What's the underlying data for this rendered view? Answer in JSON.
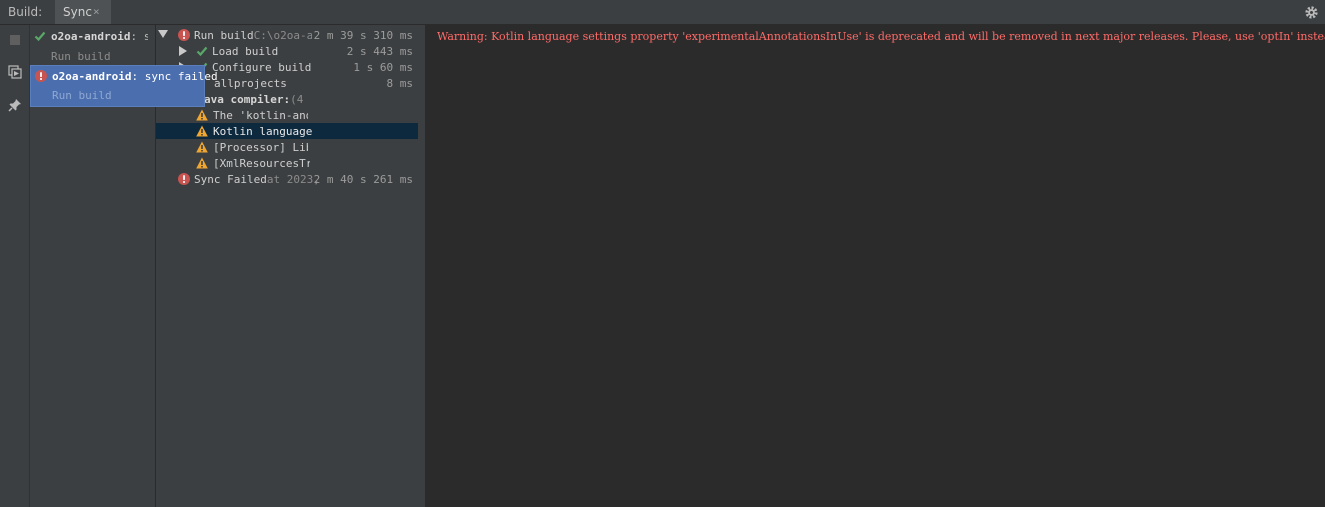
{
  "header": {
    "tool_title": "Build:",
    "tab_label": "Sync",
    "tab_close": "×"
  },
  "left_panel": {
    "items": [
      {
        "project": "o2oa-android",
        "status": ": sy",
        "sub": "Run build",
        "status_icon": "check-icon"
      },
      {
        "project": "o2oa-android",
        "status": ": sync failed",
        "sub": "Run build",
        "status_icon": "error-icon"
      }
    ]
  },
  "tree": {
    "rows": [
      {
        "label": "Run build",
        "path": " C:\\o2oa-a",
        "time": "2 m 39 s 310 ms",
        "icon": "error-icon"
      },
      {
        "label": "Load build",
        "time": "2 s 443 ms",
        "icon": "check-icon"
      },
      {
        "label": "Configure build",
        "time": "1 s 60 ms",
        "icon": "check-icon"
      },
      {
        "label": "allprojects",
        "time": "8 ms"
      },
      {
        "label": "ava compiler:",
        "detail": " (4 ",
        "icon": "warning-icon"
      },
      {
        "label": "The 'kotlin-andr",
        "icon": "warning-icon"
      },
      {
        "label": "Kotlin language",
        "icon": "warning-icon"
      },
      {
        "label": "[Processor] Libr",
        "icon": "warning-icon"
      },
      {
        "label": "[XmlResourcesTra",
        "icon": "warning-icon"
      },
      {
        "label": "Sync Failed",
        "path": " at 2023,",
        "time": "2 m 40 s 261 ms",
        "icon": "error-icon"
      }
    ]
  },
  "console": {
    "line": "Warning: Kotlin language settings property 'experimentalAnnotationsInUse' is deprecated and will be removed in next major releases. Please, use 'optIn' instead."
  },
  "colors": {
    "panel_bg": "#3c3f41",
    "console_bg": "#2b2b2b",
    "selection": "#4b6eaf",
    "tree_selection": "#0d293e",
    "error": "#c75450",
    "success": "#59a869",
    "warning": "#f0a732",
    "console_warning": "#ff6b68"
  }
}
